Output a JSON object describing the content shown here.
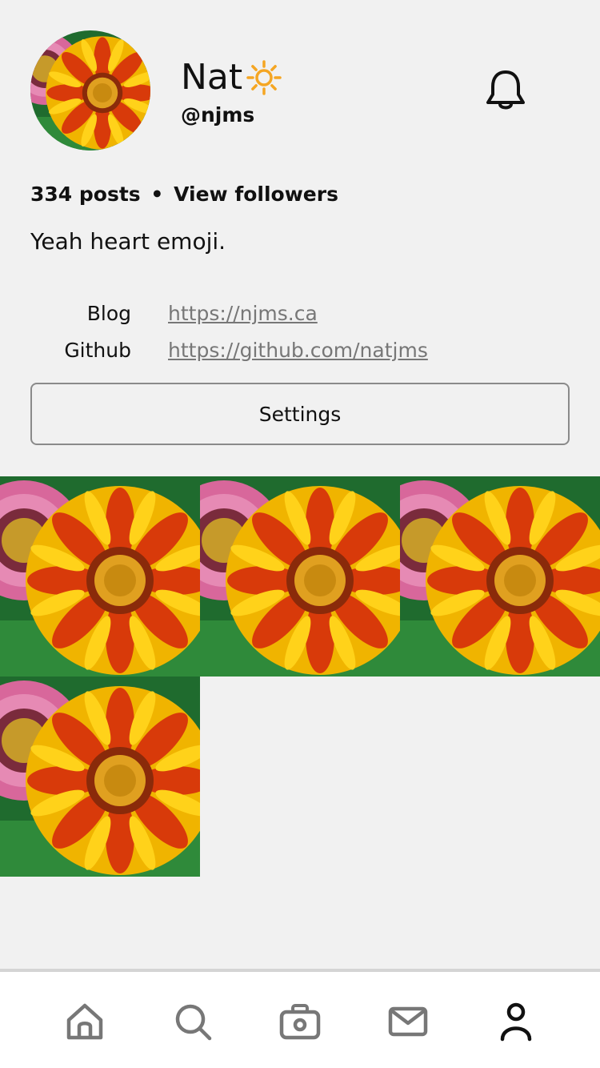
{
  "profile": {
    "display_name": "Nat",
    "handle": "@njms",
    "posts_count": "334 posts",
    "separator": "•",
    "view_followers": "View followers",
    "bio": "Yeah heart emoji."
  },
  "links": [
    {
      "label": "Blog",
      "url": "https://njms.ca"
    },
    {
      "label": "Github",
      "url": "https://github.com/natjms"
    }
  ],
  "settings_label": "Settings",
  "tabs": [
    {
      "name": "home",
      "icon": "home-icon"
    },
    {
      "name": "search",
      "icon": "search-icon"
    },
    {
      "name": "camera",
      "icon": "camera-icon"
    },
    {
      "name": "messages",
      "icon": "mail-icon"
    },
    {
      "name": "profile",
      "icon": "person-icon",
      "active": true
    }
  ],
  "colors": {
    "background": "#f1f1f1",
    "sun_emoji": "#f5a623",
    "link": "#777777",
    "inactive_icon": "#777777",
    "active_icon": "#111111"
  }
}
